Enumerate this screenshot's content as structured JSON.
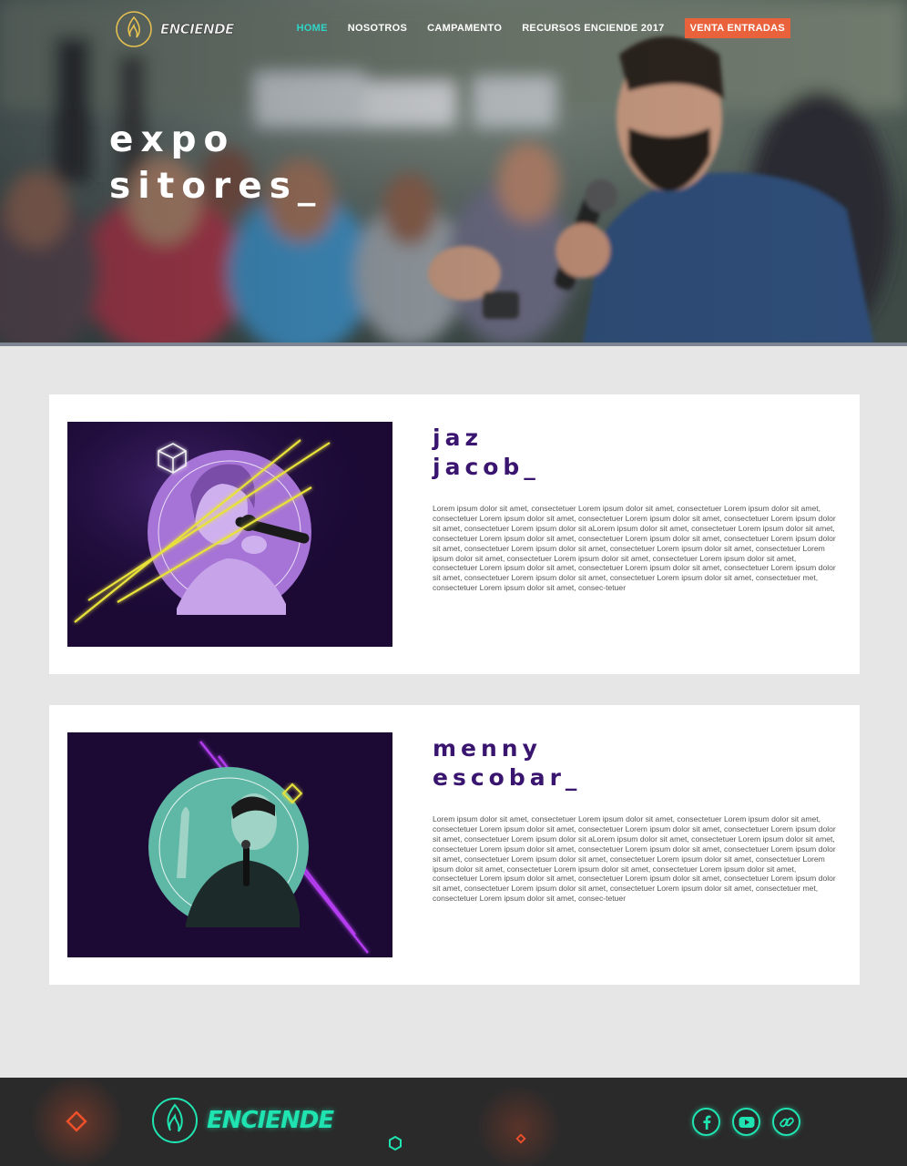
{
  "brand": {
    "name": "ENCIENDE",
    "accent": "#2fd5c6",
    "cta_color": "#e9623c",
    "footer_neon": "#1fe3b0"
  },
  "nav": {
    "items": [
      {
        "label": "HOME",
        "active": true
      },
      {
        "label": "NOSOTROS"
      },
      {
        "label": "CAMPAMENTO"
      },
      {
        "label": "RECURSOS ENCIENDE 2017"
      }
    ],
    "cta_label": "VENTA ENTRADAS"
  },
  "hero": {
    "title_line1": "expo",
    "title_line2": "sitores_"
  },
  "speakers": [
    {
      "name_line1": "jaz",
      "name_line2": "jacob_",
      "bio": "Lorem ipsum dolor sit amet, consectetuer  Lorem ipsum dolor sit amet, consectetuer  Lorem ipsum dolor sit amet, consectetuer  Lorem ipsum dolor sit amet, consectetuer  Lorem ipsum dolor sit amet, consectetuer  Lorem ipsum dolor sit amet, consectetuer  Lorem ipsum dolor sit aLorem ipsum dolor sit amet, consectetuer  Lorem ipsum dolor sit amet, consectetuer  Lorem ipsum dolor sit amet, consectetuer  Lorem ipsum dolor sit amet, consectetuer  Lorem ipsum dolor sit amet, consectetuer  Lorem ipsum dolor sit amet, consectetuer  Lorem ipsum dolor sit amet, consectetuer  Lorem ipsum dolor sit amet, consectetuer  Lorem ipsum dolor sit amet, consectetuer  Lorem ipsum dolor sit amet, consectetuer  Lorem ipsum dolor sit amet, consectetuer  Lorem ipsum dolor sit amet, consectetuer  Lorem ipsum dolor sit amet, consectetuer  Lorem ipsum dolor sit amet, consectetuer  Lorem ipsum dolor sit amet, consectetuer  met, consectetuer  Lorem ipsum dolor sit amet, consec-tetuer",
      "photo_tint": "#a674d6",
      "neon": "#e8e23a"
    },
    {
      "name_line1": "menny",
      "name_line2": "escobar_",
      "bio": "Lorem ipsum dolor sit amet, consectetuer  Lorem ipsum dolor sit amet, consectetuer  Lorem ipsum dolor sit amet, consectetuer  Lorem ipsum dolor sit amet, consectetuer  Lorem ipsum dolor sit amet, consectetuer  Lorem ipsum dolor sit amet, consectetuer  Lorem ipsum dolor sit aLorem ipsum dolor sit amet, consectetuer  Lorem ipsum dolor sit amet, consectetuer  Lorem ipsum dolor sit amet, consectetuer  Lorem ipsum dolor sit amet, consectetuer  Lorem ipsum dolor sit amet, consectetuer  Lorem ipsum dolor sit amet, consectetuer  Lorem ipsum dolor sit amet, consectetuer  Lorem ipsum dolor sit amet, consectetuer  Lorem ipsum dolor sit amet, consectetuer  Lorem ipsum dolor sit amet, consectetuer  Lorem ipsum dolor sit amet, consectetuer  Lorem ipsum dolor sit amet, consectetuer  Lorem ipsum dolor sit amet, consectetuer  Lorem ipsum dolor sit amet, consectetuer  Lorem ipsum dolor sit amet, consectetuer  met, consectetuer  Lorem ipsum dolor sit amet, consec-tetuer",
      "photo_tint": "#5fb8a6",
      "neon": "#b43cf0"
    }
  ],
  "footer": {
    "brand": "ENCIENDE",
    "socials": [
      {
        "icon": "facebook-icon"
      },
      {
        "icon": "youtube-icon"
      },
      {
        "icon": "link-icon"
      }
    ]
  }
}
